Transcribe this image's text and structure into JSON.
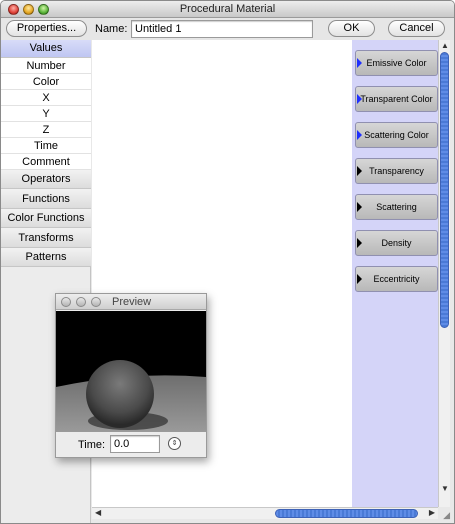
{
  "window": {
    "title": "Procedural Material"
  },
  "toolbar": {
    "properties_label": "Properties...",
    "name_label": "Name:",
    "name_value": "Untitled 1",
    "ok_label": "OK",
    "cancel_label": "Cancel"
  },
  "sidebar": {
    "selected": "Values",
    "items": [
      {
        "label": "Values",
        "kind": "header"
      },
      {
        "label": "Number",
        "kind": "sub"
      },
      {
        "label": "Color",
        "kind": "sub"
      },
      {
        "label": "X",
        "kind": "sub"
      },
      {
        "label": "Y",
        "kind": "sub"
      },
      {
        "label": "Z",
        "kind": "sub"
      },
      {
        "label": "Time",
        "kind": "sub"
      },
      {
        "label": "Comment",
        "kind": "sub"
      },
      {
        "label": "Operators",
        "kind": "group"
      },
      {
        "label": "Functions",
        "kind": "group"
      },
      {
        "label": "Color Functions",
        "kind": "group"
      },
      {
        "label": "Transforms",
        "kind": "group"
      },
      {
        "label": "Patterns",
        "kind": "group"
      }
    ]
  },
  "outputs": [
    {
      "label": "Emissive Color",
      "arrow": "blue"
    },
    {
      "label": "Transparent Color",
      "arrow": "blue"
    },
    {
      "label": "Scattering Color",
      "arrow": "blue"
    },
    {
      "label": "Transparency",
      "arrow": "black"
    },
    {
      "label": "Scattering",
      "arrow": "black"
    },
    {
      "label": "Density",
      "arrow": "black"
    },
    {
      "label": "Eccentricity",
      "arrow": "black"
    }
  ],
  "preview": {
    "title": "Preview",
    "time_label": "Time:",
    "time_value": "0.0"
  },
  "colors": {
    "sidebar_selected": "#c4caf4",
    "outputs_panel": "#d4d4f8",
    "scroll_thumb": "#4a7ad6"
  }
}
